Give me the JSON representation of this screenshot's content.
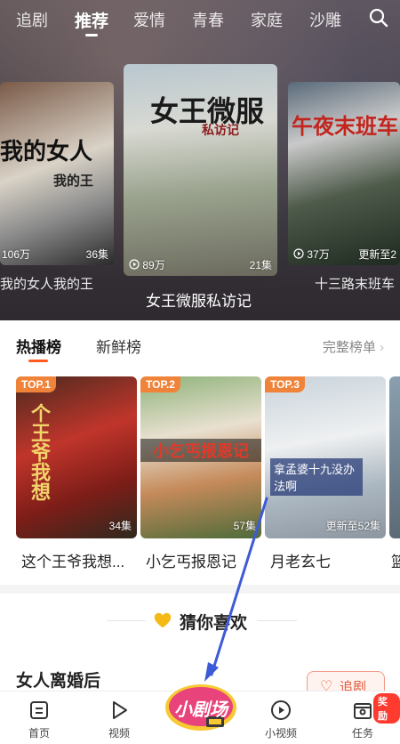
{
  "nav": {
    "tabs": [
      "追剧",
      "推荐",
      "爱情",
      "青春",
      "家庭",
      "沙雕"
    ],
    "active_tab": "推荐"
  },
  "carousel": [
    {
      "poster_text": "我的女人",
      "poster_sub": "我的王",
      "views": "106万",
      "episodes": "36集",
      "title": "我的女人我的王"
    },
    {
      "poster_text": "女王微服",
      "poster_sub": "私访记",
      "views": "89万",
      "episodes": "21集",
      "title": "女王微服私访记"
    },
    {
      "poster_text": "午夜末班车",
      "poster_sub": "",
      "views": "37万",
      "episodes": "更新至2",
      "title": "十三路末班车"
    }
  ],
  "rank": {
    "tabs": [
      "热播榜",
      "新鲜榜"
    ],
    "full_list": "完整榜单",
    "items": [
      {
        "badge": "TOP.1",
        "episodes": "34集",
        "title": "这个王爷我想...",
        "poster_text": "个王爷我想"
      },
      {
        "badge": "TOP.2",
        "episodes": "57集",
        "title": "小乞丐报恩记",
        "poster_text": "小乞丐报恩记"
      },
      {
        "badge": "TOP.3",
        "episodes": "更新至52集",
        "title": "月老玄七",
        "poster_text": "拿孟婆十九没办法啊"
      }
    ],
    "partial_title": "篮"
  },
  "guess": {
    "title": "猜你喜欢"
  },
  "recommend": {
    "title": "女人离婚后",
    "follow_label": "追剧"
  },
  "bottom": {
    "items": [
      "首页",
      "视频",
      "小视频",
      "任务"
    ],
    "center_logo": "小剧场",
    "reward_badge": "奖励"
  },
  "colors": {
    "accent": "#ff5a1f",
    "badge": "#f0833a",
    "reward": "#ff3b30",
    "annotation": "#3d5bd6"
  }
}
